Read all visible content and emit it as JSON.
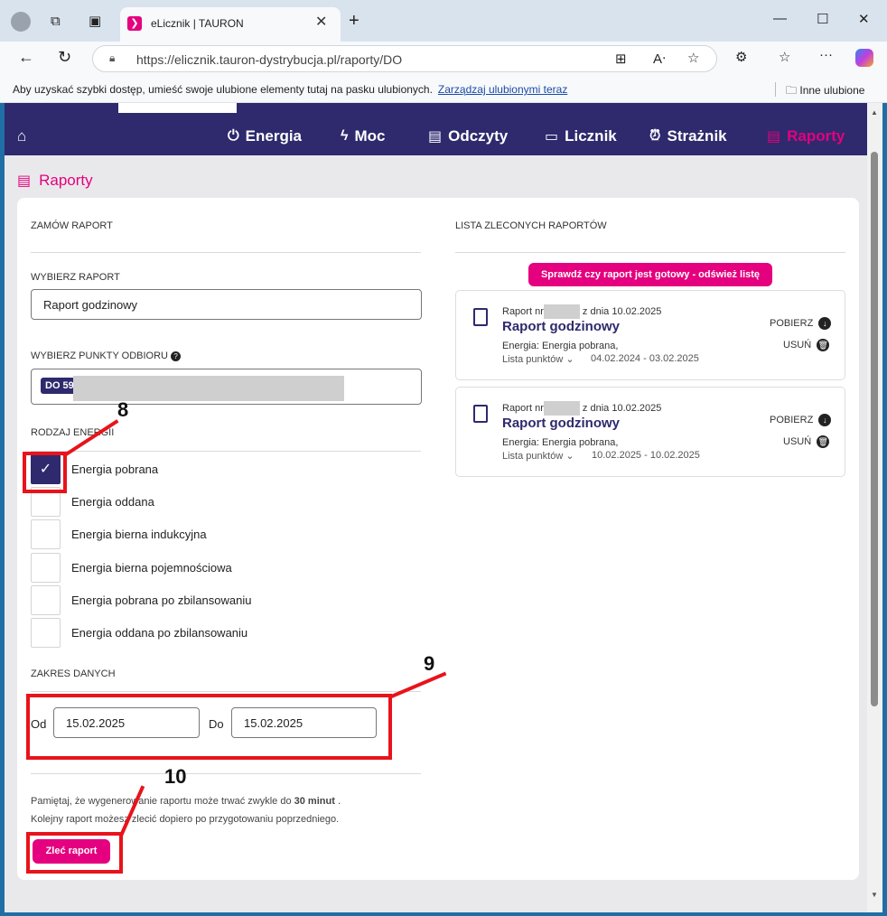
{
  "browser": {
    "tab_title": "eLicznik | TAURON",
    "url": "https://elicznik.tauron-dystrybucja.pl/raporty/DO",
    "favbar_text": "Aby uzyskać szybki dostęp, umieść swoje ulubione elementy tutaj na pasku ulubionych.",
    "favbar_link": "Zarządzaj ulubionymi teraz",
    "other_favorites": "Inne ulubione"
  },
  "nav": {
    "items": [
      {
        "label": "Energia",
        "icon": "plug-icon"
      },
      {
        "label": "Moc",
        "icon": "lightning-icon"
      },
      {
        "label": "Odczyty",
        "icon": "clipboard-icon"
      },
      {
        "label": "Licznik",
        "icon": "meter-icon"
      },
      {
        "label": "Strażnik",
        "icon": "alarm-icon"
      },
      {
        "label": "Raporty",
        "icon": "report-icon"
      }
    ],
    "active_color": "#e4007e",
    "bg_color": "#2e2a6d"
  },
  "page_title": "Raporty",
  "order": {
    "heading": "ZAMÓW RAPORT",
    "report_label": "WYBIERZ RAPORT",
    "report_value": "Raport godzinowy",
    "points_label": "WYBIERZ PUNKTY ODBIORU",
    "point_badge": "DO 59",
    "energy_label": "RODZAJ ENERGII",
    "energy_options": [
      {
        "label": "Energia pobrana",
        "checked": true
      },
      {
        "label": "Energia oddana",
        "checked": false
      },
      {
        "label": "Energia bierna indukcyjna",
        "checked": false
      },
      {
        "label": "Energia bierna pojemnościowa",
        "checked": false
      },
      {
        "label": "Energia pobrana po zbilansowaniu",
        "checked": false
      },
      {
        "label": "Energia oddana po zbilansowaniu",
        "checked": false
      }
    ],
    "range_label": "ZAKRES DANYCH",
    "from_label": "Od",
    "from_value": "15.02.2025",
    "to_label": "Do",
    "to_value": "15.02.2025",
    "note_line1_a": "Pamiętaj, że wygenerowanie raportu może trwać zwykle do",
    "note_line1_bold": "30 minut",
    "note_line1_b": ".",
    "note_line2": "Kolejny raport możesz zlecić dopiero po przygotowaniu poprzedniego.",
    "submit_label": "Zleć raport"
  },
  "list": {
    "heading": "LISTA ZLECONYCH RAPORTÓW",
    "refresh_label": "Sprawdź czy raport jest gotowy - odśwież listę",
    "reports": [
      {
        "prefix": "Raport nr",
        "suffix": "z dnia 10.02.2025",
        "title": "Raport godzinowy",
        "energy": "Energia: Energia pobrana,",
        "points": "Lista punktów",
        "range": "04.02.2024 - 03.02.2025",
        "download": "POBIERZ",
        "delete": "USUŃ"
      },
      {
        "prefix": "Raport nr",
        "suffix": "z dnia 10.02.2025",
        "title": "Raport godzinowy",
        "energy": "Energia: Energia pobrana,",
        "points": "Lista punktów",
        "range": "10.02.2025 - 10.02.2025",
        "download": "POBIERZ",
        "delete": "USUŃ"
      }
    ]
  },
  "annotations": {
    "n8": "8",
    "n9": "9",
    "n10": "10"
  }
}
